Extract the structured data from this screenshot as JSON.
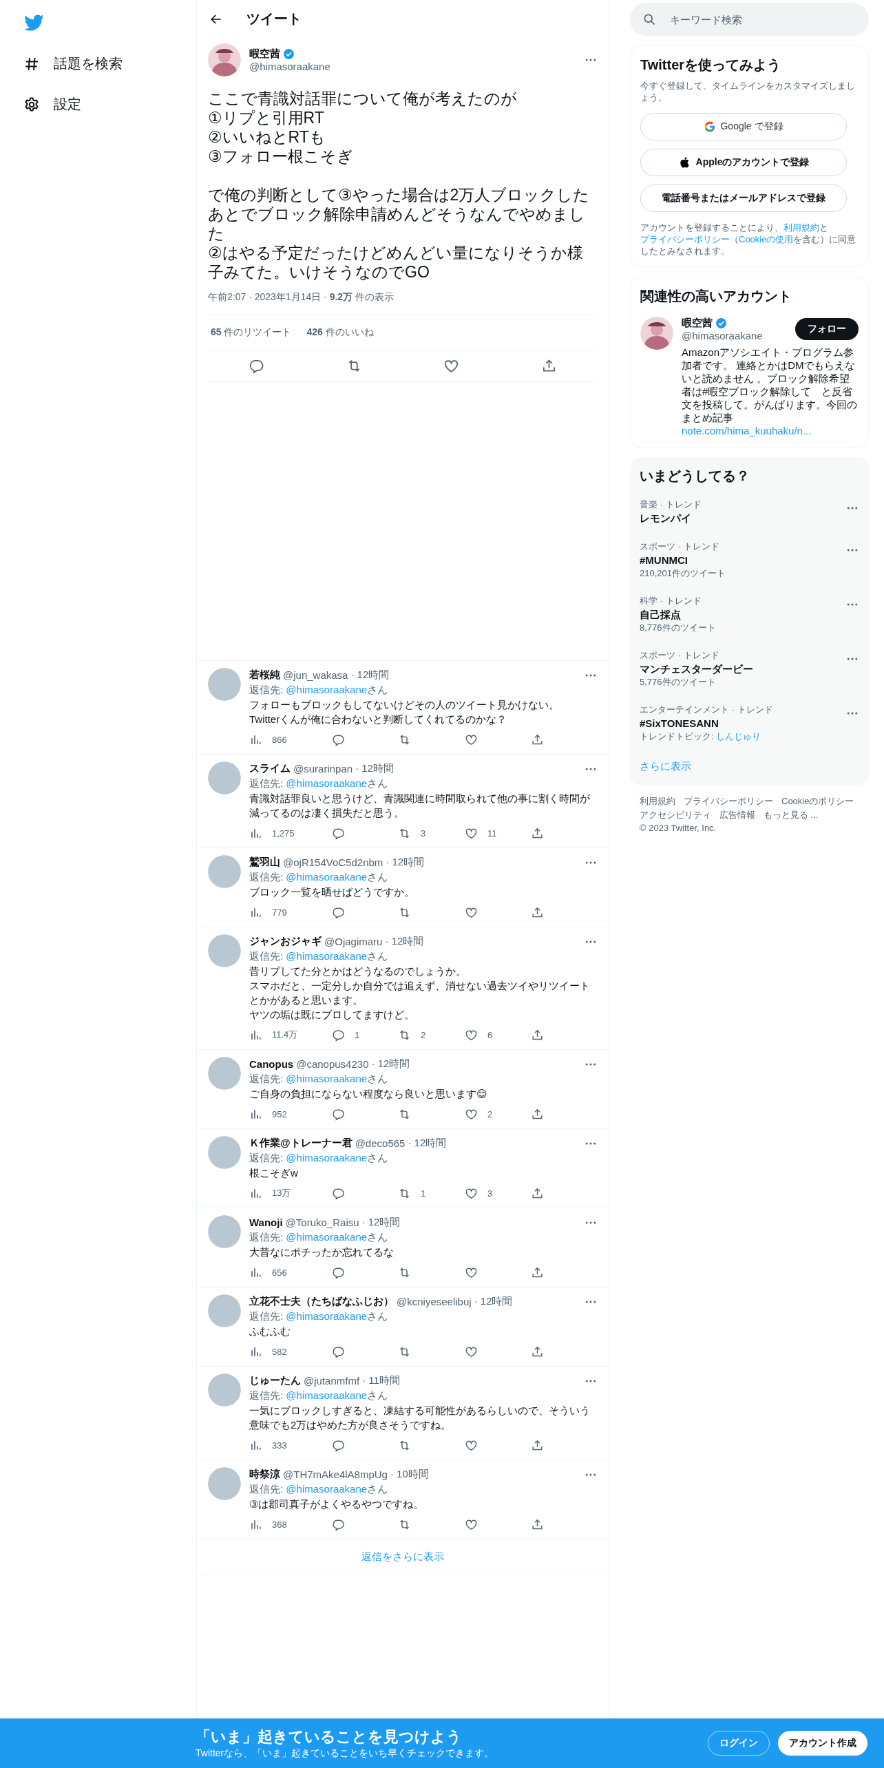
{
  "nav": {
    "items": [
      {
        "label": "話題を検索"
      },
      {
        "label": "設定"
      }
    ]
  },
  "header": {
    "title": "ツイート"
  },
  "tweet": {
    "name": "暇空茜",
    "verified": true,
    "handle": "@himasoraakane",
    "paragraphs": [
      [
        "ここで青識対話罪について俺が考えたのが",
        "①リプと引用RT",
        "②いいねとRTも",
        "③フォロー根こそぎ"
      ],
      [
        "で俺の判断として③やった場合は2万人ブロックしたあとでブロック解除申請めんどそうなんでやめました",
        "②はやる予定だったけどめんどい量になりそうか様子みてた。いけそうなのでGO"
      ]
    ],
    "meta": "午前2:07 · 2023年1月14日 · **9.2万** 件の表示",
    "stats": [
      "**65** 件のリツイート",
      "**426** 件のいいね"
    ]
  },
  "replies": [
    {
      "name": "若桜純",
      "handle": "@jun_wakasa",
      "time": "· 12時間",
      "reply_to": [
        {
          "kind": "text",
          "text": "返信先: "
        },
        {
          "kind": "link",
          "text": "@himasoraakane"
        },
        {
          "kind": "text",
          "text": "さん"
        }
      ],
      "text": [
        "フォローもブロックもしてないけどその人のツイート見かけない。",
        "Twitterくんが俺に合わないと判断してくれてるのかな？"
      ],
      "views": "866"
    },
    {
      "name": "スライム",
      "handle": "@surarinpan",
      "time": "· 12時間",
      "reply_to": [
        {
          "kind": "text",
          "text": "返信先: "
        },
        {
          "kind": "link",
          "text": "@himasoraakane"
        },
        {
          "kind": "text",
          "text": "さん"
        }
      ],
      "text": [
        "青識対話罪良いと思うけど、青識関連に時間取られて他の事に割く時間が減ってるのは凄く損失だと思う。"
      ],
      "views": "1,275",
      "retweets": "3",
      "likes": "11"
    },
    {
      "name": "鷲羽山",
      "handle": "@ojR154VoC5d2nbm",
      "time": "· 12時間",
      "reply_to": [
        {
          "kind": "text",
          "text": "返信先: "
        },
        {
          "kind": "link",
          "text": "@himasoraakane"
        },
        {
          "kind": "text",
          "text": "さん"
        }
      ],
      "text": [
        "ブロック一覧を晒せばどうですか。"
      ],
      "views": "779"
    },
    {
      "name": "ジャンおジャギ",
      "handle": "@Ojagimaru",
      "time": "· 12時間",
      "reply_to": [
        {
          "kind": "text",
          "text": "返信先: "
        },
        {
          "kind": "link",
          "text": "@himasoraakane"
        },
        {
          "kind": "text",
          "text": "さん"
        }
      ],
      "text": [
        "昔リプしてた分とかはどうなるのでしょうか。",
        "スマホだと、一定分しか自分では追えず、消せない過去ツイやリツイートとかがあると思います。",
        "ヤツの垢は既にブロしてますけど。"
      ],
      "views": "11.4万",
      "replies": "1",
      "retweets": "2",
      "likes": "6"
    },
    {
      "name": "Canopus",
      "handle": "@canopus4230",
      "time": "· 12時間",
      "reply_to": [
        {
          "kind": "text",
          "text": "返信先: "
        },
        {
          "kind": "link",
          "text": "@himasoraakane"
        },
        {
          "kind": "text",
          "text": "さん"
        }
      ],
      "text": [
        "ご自身の負担にならない程度なら良いと思います😌"
      ],
      "views": "952",
      "likes": "2"
    },
    {
      "name": "Ｋ作業@トレーナー君",
      "handle": "@deco565",
      "time": "· 12時間",
      "reply_to": [
        {
          "kind": "text",
          "text": "返信先: "
        },
        {
          "kind": "link",
          "text": "@himasoraakane"
        },
        {
          "kind": "text",
          "text": "さん"
        }
      ],
      "text": [
        "根こそぎw"
      ],
      "views": "13万",
      "retweets": "1",
      "likes": "3"
    },
    {
      "name": "Wanoji",
      "handle": "@Toruko_Raisu",
      "time": "· 12時間",
      "reply_to": [
        {
          "kind": "text",
          "text": "返信先: "
        },
        {
          "kind": "link",
          "text": "@himasoraakane"
        },
        {
          "kind": "text",
          "text": "さん"
        }
      ],
      "text": [
        "大昔なにポチったか忘れてるな"
      ],
      "views": "656"
    },
    {
      "name": "立花不士夫（たちばなふじお）",
      "handle": "@kcniyeseelibuj",
      "time": "· 12時間",
      "reply_to": [
        {
          "kind": "text",
          "text": "返信先: "
        },
        {
          "kind": "link",
          "text": "@himasoraakane"
        },
        {
          "kind": "text",
          "text": "さん"
        }
      ],
      "text": [
        "ふむふむ"
      ],
      "views": "582"
    },
    {
      "name": "じゅーたん",
      "handle": "@jutanmfmf",
      "time": "· 11時間",
      "reply_to": [
        {
          "kind": "text",
          "text": "返信先: "
        },
        {
          "kind": "link",
          "text": "@himasoraakane"
        },
        {
          "kind": "text",
          "text": "さん"
        }
      ],
      "text": [
        "一気にブロックしすぎると、凍結する可能性があるらしいので、そういう意味でも2万はやめた方が良さそうですね。"
      ],
      "views": "333"
    },
    {
      "name": "時祭涼",
      "handle": "@TH7mAke4lA8mpUg",
      "time": "· 10時間",
      "reply_to": [
        {
          "kind": "text",
          "text": "返信先: "
        },
        {
          "kind": "link",
          "text": "@himasoraakane"
        },
        {
          "kind": "text",
          "text": "さん"
        }
      ],
      "text": [
        "③は郡司真子がよくやるやつですね。"
      ],
      "views": "368"
    }
  ],
  "show_more_replies": "返信をさらに表示",
  "search": {
    "placeholder": "キーワード検索"
  },
  "signup": {
    "title": "Twitterを使ってみよう",
    "description": "今すぐ登録して、タイムラインをカスタマイズしましょう。",
    "buttons": [
      {
        "kind": "google",
        "label": "Google で登録"
      },
      {
        "kind": "apple",
        "label": "Appleのアカウントで登録"
      },
      {
        "kind": "plain",
        "label": "電話番号またはメールアドレスで登録"
      }
    ],
    "legal": [
      {
        "kind": "text",
        "text": "アカウントを登録することにより、"
      },
      {
        "kind": "link",
        "text": "利用規約"
      },
      {
        "kind": "text",
        "text": "と"
      },
      {
        "kind": "link",
        "text": "プライバシーポリシー"
      },
      {
        "kind": "text",
        "text": "（"
      },
      {
        "kind": "link",
        "text": "Cookieの使用"
      },
      {
        "kind": "text",
        "text": "を含む）に同意したとみなされます。"
      }
    ]
  },
  "related": {
    "title": "関連性の高いアカウント",
    "name": "暇空茜",
    "verified": true,
    "handle": "@himasoraakane",
    "follow": "フォロー",
    "bio": [
      {
        "kind": "text",
        "text": "Amazonアソシエイト・プログラム参加者です。 連絡とかはDMでもらえないと読めません 。ブロック解除希望者は#暇空ブロック解除して　と反省文を投稿して。がんばります。今回のまとめ記事"
      },
      {
        "kind": "link",
        "text": "note.com/hima_kuuhaku/n..."
      }
    ]
  },
  "trends": {
    "title": "いまどうしてる？",
    "items": [
      {
        "category": "音楽 · トレンド",
        "name": "レモンパイ"
      },
      {
        "category": "スポーツ · トレンド",
        "name": "#MUNMCI",
        "detail": [
          {
            "kind": "text",
            "text": "210,201件のツイート"
          }
        ]
      },
      {
        "category": "科学 · トレンド",
        "name": "自己採点",
        "detail": [
          {
            "kind": "text",
            "text": "8,776件のツイート"
          }
        ]
      },
      {
        "category": "スポーツ · トレンド",
        "name": "マンチェスターダービー",
        "detail": [
          {
            "kind": "text",
            "text": "5,776件のツイート"
          }
        ]
      },
      {
        "category": "エンターテインメント · トレンド",
        "name": "#SixTONESANN",
        "detail": [
          {
            "kind": "text",
            "text": "トレンドトピック: "
          },
          {
            "kind": "link",
            "text": "しんじゅり"
          }
        ]
      }
    ],
    "show_more": "さらに表示"
  },
  "footer": [
    "利用規約",
    "プライバシーポリシー",
    "Cookieのポリシー",
    "アクセシビリティ",
    "広告情報",
    "もっと見る ...",
    "© 2023 Twitter, Inc."
  ],
  "bottom_bar": {
    "title": "「いま」起きていることを見つけよう",
    "subtitle": "Twitterなら、「いま」起きていることをいち早くチェックできます。",
    "login": "ログイン",
    "signup": "アカウント作成"
  }
}
